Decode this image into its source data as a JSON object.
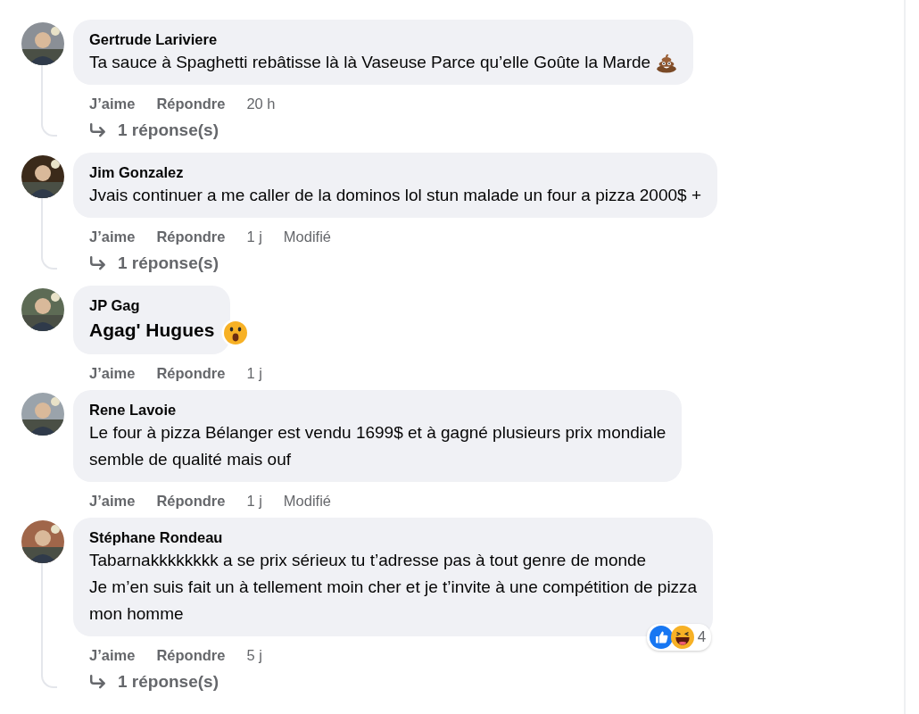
{
  "comments": [
    {
      "author": "Gertrude Lariviere",
      "text": "Ta sauce à Spaghetti rebâtisse là là Vaseuse Parce qu’elle Goûte la Marde",
      "emoji": {
        "kind": "poo"
      },
      "large": false,
      "actions": [
        "J’aime",
        "Répondre"
      ],
      "time": "20 h",
      "replies": "1 réponse(s)"
    },
    {
      "author": "Jim Gonzalez",
      "text": "Jvais continuer a me caller de la dominos lol stun malade un four a pizza 2000$ +",
      "large": false,
      "actions": [
        "J’aime",
        "Répondre"
      ],
      "time": "1 j",
      "edited": "Modifié",
      "replies": "1 réponse(s)"
    },
    {
      "author": "JP Gag",
      "text": "Agag' Hugues",
      "large": true,
      "reaction": {
        "kind": "wow"
      },
      "actions": [
        "J’aime",
        "Répondre"
      ],
      "time": "1 j"
    },
    {
      "author": "Rene Lavoie",
      "text": "Le four à pizza Bélanger est vendu 1699$ et à gagné plusieurs prix mondiale\nsemble de qualité mais ouf",
      "large": false,
      "actions": [
        "J’aime",
        "Répondre"
      ],
      "time": "1 j",
      "edited": "Modifié"
    },
    {
      "author": "Stéphane Rondeau",
      "text": "Tabarnakkkkkkkk a se prix sérieux tu t’adresse pas à tout genre de monde\nJe m’en suis fait un à tellement moin cher et je t’invite à une compétition de pizza\nmon homme",
      "large": false,
      "reactions": {
        "types": [
          {
            "kind": "like"
          },
          {
            "kind": "haha"
          }
        ],
        "count": "4"
      },
      "actions": [
        "J’aime",
        "Répondre"
      ],
      "time": "5 j",
      "replies": "1 réponse(s)"
    }
  ]
}
